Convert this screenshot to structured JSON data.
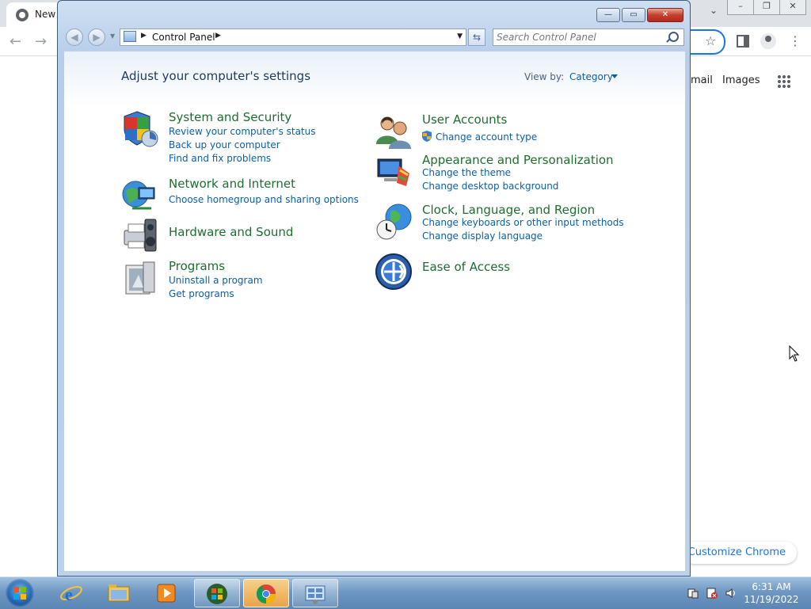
{
  "browser": {
    "tab_title": "New",
    "window_buttons": [
      "–",
      "❐",
      "✕"
    ],
    "tab_list_icon": "chevron-down-icon",
    "google_links": {
      "gmail": "mail",
      "images": "Images"
    },
    "customize_chrome": "Customize Chrome"
  },
  "window": {
    "caption_buttons": {
      "minimize": "—",
      "maximize": "▭",
      "close": "✕"
    },
    "breadcrumb": {
      "location": "Control Panel"
    },
    "search": {
      "placeholder": "Search Control Panel"
    }
  },
  "control_panel": {
    "heading": "Adjust your computer's settings",
    "view_by_label": "View by:",
    "view_by_value": "Category",
    "left_categories": [
      {
        "title": "System and Security",
        "icon": "shield-icon",
        "links": [
          "Review your computer's status",
          "Back up your computer",
          "Find and fix problems"
        ]
      },
      {
        "title": "Network and Internet",
        "icon": "network-globe-icon",
        "links": [
          "Choose homegroup and sharing options"
        ]
      },
      {
        "title": "Hardware and Sound",
        "icon": "printer-speaker-icon",
        "links": []
      },
      {
        "title": "Programs",
        "icon": "programs-box-icon",
        "links": [
          "Uninstall a program",
          "Get programs"
        ]
      }
    ],
    "right_categories": [
      {
        "title": "User Accounts",
        "icon": "users-icon",
        "links": [
          "Change account type"
        ]
      },
      {
        "title": "Appearance and Personalization",
        "icon": "monitor-palette-icon",
        "links": [
          "Change the theme",
          "Change desktop background"
        ]
      },
      {
        "title": "Clock, Language, and Region",
        "icon": "clock-globe-icon",
        "links": [
          "Change keyboards or other input methods",
          "Change display language"
        ]
      },
      {
        "title": "Ease of Access",
        "icon": "ease-of-access-icon",
        "links": []
      }
    ]
  },
  "taskbar": {
    "items": [
      "start-orb-icon",
      "internet-explorer-icon",
      "file-explorer-icon",
      "media-player-icon",
      "windows-logo-icon",
      "chrome-icon",
      "control-panel-icon"
    ],
    "clock": {
      "time": "6:31 AM",
      "date": "11/19/2022"
    }
  }
}
